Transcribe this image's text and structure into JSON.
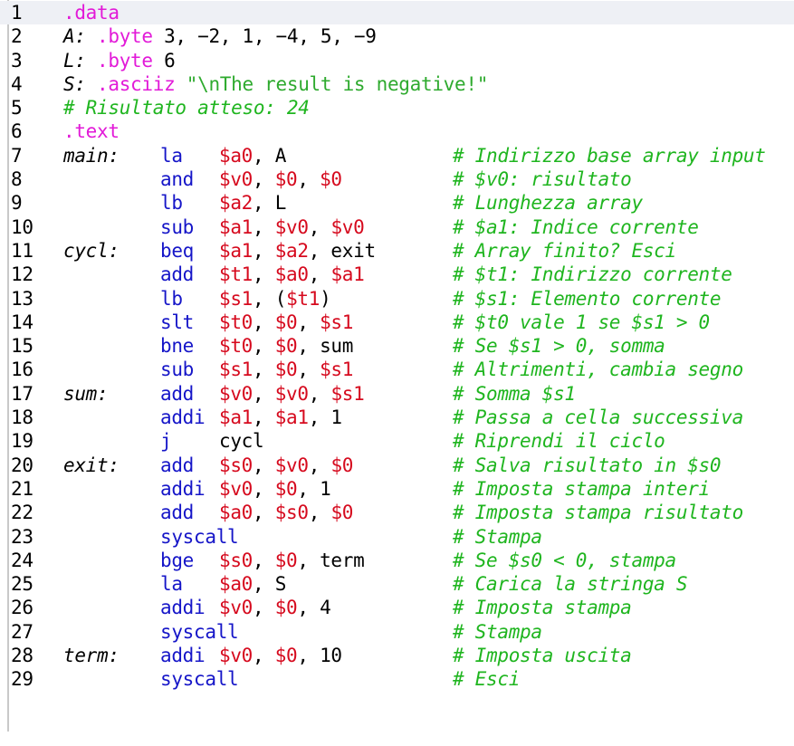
{
  "editor": {
    "current_line": 1,
    "lines": [
      {
        "n": "1",
        "label": "",
        "code": [
          [
            "dir",
            ".data"
          ]
        ]
      },
      {
        "n": "2",
        "label": "",
        "code": [
          [
            "lbl",
            "A: "
          ],
          [
            "dir",
            ".byte"
          ],
          [
            "kw",
            " 3, −2, 1, −4, 5, −9"
          ]
        ]
      },
      {
        "n": "3",
        "label": "",
        "code": [
          [
            "lbl",
            "L: "
          ],
          [
            "dir",
            ".byte"
          ],
          [
            "kw",
            " 6"
          ]
        ]
      },
      {
        "n": "4",
        "label": "",
        "code": [
          [
            "lbl",
            "S: "
          ],
          [
            "dir",
            ".asciiz"
          ],
          [
            "kw",
            " "
          ],
          [
            "str",
            "\"\\nThe result is negative!\""
          ]
        ]
      },
      {
        "n": "5",
        "label": "",
        "code": [
          [
            "cmt",
            "# Risultato atteso: 24"
          ]
        ]
      },
      {
        "n": "6",
        "label": "",
        "code": [
          [
            "dir",
            ".text"
          ]
        ]
      },
      {
        "n": "7",
        "label": "main:",
        "mnemonic": "la",
        "operands": [
          [
            "reg",
            "$a0"
          ],
          [
            "kw",
            ", A"
          ]
        ],
        "comment": "# Indirizzo base array input"
      },
      {
        "n": "8",
        "label": "",
        "mnemonic": "and",
        "operands": [
          [
            "reg",
            "$v0"
          ],
          [
            "kw",
            ", "
          ],
          [
            "reg",
            "$0"
          ],
          [
            "kw",
            ", "
          ],
          [
            "reg",
            "$0"
          ]
        ],
        "comment": "# $v0: risultato"
      },
      {
        "n": "9",
        "label": "",
        "mnemonic": "lb",
        "operands": [
          [
            "reg",
            "$a2"
          ],
          [
            "kw",
            ", L"
          ]
        ],
        "comment": "# Lunghezza array"
      },
      {
        "n": "10",
        "label": "",
        "mnemonic": "sub",
        "operands": [
          [
            "reg",
            "$a1"
          ],
          [
            "kw",
            ", "
          ],
          [
            "reg",
            "$v0"
          ],
          [
            "kw",
            ", "
          ],
          [
            "reg",
            "$v0"
          ]
        ],
        "comment": "# $a1: Indice corrente"
      },
      {
        "n": "11",
        "label": "cycl:",
        "mnemonic": "beq",
        "operands": [
          [
            "reg",
            "$a1"
          ],
          [
            "kw",
            ", "
          ],
          [
            "reg",
            "$a2"
          ],
          [
            "kw",
            ", exit"
          ]
        ],
        "comment": "# Array finito? Esci"
      },
      {
        "n": "12",
        "label": "",
        "mnemonic": "add",
        "operands": [
          [
            "reg",
            "$t1"
          ],
          [
            "kw",
            ", "
          ],
          [
            "reg",
            "$a0"
          ],
          [
            "kw",
            ", "
          ],
          [
            "reg",
            "$a1"
          ]
        ],
        "comment": "# $t1: Indirizzo corrente"
      },
      {
        "n": "13",
        "label": "",
        "mnemonic": "lb",
        "operands": [
          [
            "reg",
            "$s1"
          ],
          [
            "kw",
            ", ("
          ],
          [
            "reg",
            "$t1"
          ],
          [
            "kw",
            ")"
          ]
        ],
        "comment": "# $s1: Elemento corrente"
      },
      {
        "n": "14",
        "label": "",
        "mnemonic": "slt",
        "operands": [
          [
            "reg",
            "$t0"
          ],
          [
            "kw",
            ", "
          ],
          [
            "reg",
            "$0"
          ],
          [
            "kw",
            ", "
          ],
          [
            "reg",
            "$s1"
          ]
        ],
        "comment": "# $t0 vale 1 se $s1 > 0"
      },
      {
        "n": "15",
        "label": "",
        "mnemonic": "bne",
        "operands": [
          [
            "reg",
            "$t0"
          ],
          [
            "kw",
            ", "
          ],
          [
            "reg",
            "$0"
          ],
          [
            "kw",
            ", sum"
          ]
        ],
        "comment": "# Se $s1 > 0, somma"
      },
      {
        "n": "16",
        "label": "",
        "mnemonic": "sub",
        "operands": [
          [
            "reg",
            "$s1"
          ],
          [
            "kw",
            ", "
          ],
          [
            "reg",
            "$0"
          ],
          [
            "kw",
            ", "
          ],
          [
            "reg",
            "$s1"
          ]
        ],
        "comment": "# Altrimenti, cambia segno"
      },
      {
        "n": "17",
        "label": "sum:",
        "mnemonic": "add",
        "operands": [
          [
            "reg",
            "$v0"
          ],
          [
            "kw",
            ", "
          ],
          [
            "reg",
            "$v0"
          ],
          [
            "kw",
            ", "
          ],
          [
            "reg",
            "$s1"
          ]
        ],
        "comment": "# Somma $s1"
      },
      {
        "n": "18",
        "label": "",
        "mnemonic": "addi",
        "operands": [
          [
            "reg",
            "$a1"
          ],
          [
            "kw",
            ", "
          ],
          [
            "reg",
            "$a1"
          ],
          [
            "kw",
            ", 1"
          ]
        ],
        "comment": "# Passa a cella successiva"
      },
      {
        "n": "19",
        "label": "",
        "mnemonic": "j",
        "operands": [
          [
            "kw",
            "cycl"
          ]
        ],
        "comment": "# Riprendi il ciclo"
      },
      {
        "n": "20",
        "label": "exit:",
        "mnemonic": "add",
        "operands": [
          [
            "reg",
            "$s0"
          ],
          [
            "kw",
            ", "
          ],
          [
            "reg",
            "$v0"
          ],
          [
            "kw",
            ", "
          ],
          [
            "reg",
            "$0"
          ]
        ],
        "comment": "# Salva risultato in $s0"
      },
      {
        "n": "21",
        "label": "",
        "mnemonic": "addi",
        "operands": [
          [
            "reg",
            "$v0"
          ],
          [
            "kw",
            ", "
          ],
          [
            "reg",
            "$0"
          ],
          [
            "kw",
            ", 1"
          ]
        ],
        "comment": "# Imposta stampa interi"
      },
      {
        "n": "22",
        "label": "",
        "mnemonic": "add",
        "operands": [
          [
            "reg",
            "$a0"
          ],
          [
            "kw",
            ", "
          ],
          [
            "reg",
            "$s0"
          ],
          [
            "kw",
            ", "
          ],
          [
            "reg",
            "$0"
          ]
        ],
        "comment": "# Imposta stampa risultato"
      },
      {
        "n": "23",
        "label": "",
        "mnemonic": "syscall",
        "operands": [],
        "comment": "# Stampa"
      },
      {
        "n": "24",
        "label": "",
        "mnemonic": "bge",
        "operands": [
          [
            "reg",
            "$s0"
          ],
          [
            "kw",
            ", "
          ],
          [
            "reg",
            "$0"
          ],
          [
            "kw",
            ", term"
          ]
        ],
        "comment": "# Se $s0 < 0, stampa"
      },
      {
        "n": "25",
        "label": "",
        "mnemonic": "la",
        "operands": [
          [
            "reg",
            "$a0"
          ],
          [
            "kw",
            ", S"
          ]
        ],
        "comment": "# Carica la stringa S"
      },
      {
        "n": "26",
        "label": "",
        "mnemonic": "addi",
        "operands": [
          [
            "reg",
            "$v0"
          ],
          [
            "kw",
            ", "
          ],
          [
            "reg",
            "$0"
          ],
          [
            "kw",
            ", 4"
          ]
        ],
        "comment": "# Imposta stampa"
      },
      {
        "n": "27",
        "label": "",
        "mnemonic": "syscall",
        "operands": [],
        "comment": "# Stampa"
      },
      {
        "n": "28",
        "label": "term:",
        "mnemonic": "addi",
        "operands": [
          [
            "reg",
            "$v0"
          ],
          [
            "kw",
            ", "
          ],
          [
            "reg",
            "$0"
          ],
          [
            "kw",
            ", 10"
          ]
        ],
        "comment": "# Imposta uscita"
      },
      {
        "n": "29",
        "label": "",
        "mnemonic": "syscall",
        "operands": [],
        "comment": "# Esci"
      }
    ]
  },
  "colors": {
    "directive": "#e21ad8",
    "mnemonic": "#1515c8",
    "register": "#d60a1e",
    "comment": "#1fb51f",
    "string": "#2eaa2e",
    "current_line": "#eef0f5"
  }
}
